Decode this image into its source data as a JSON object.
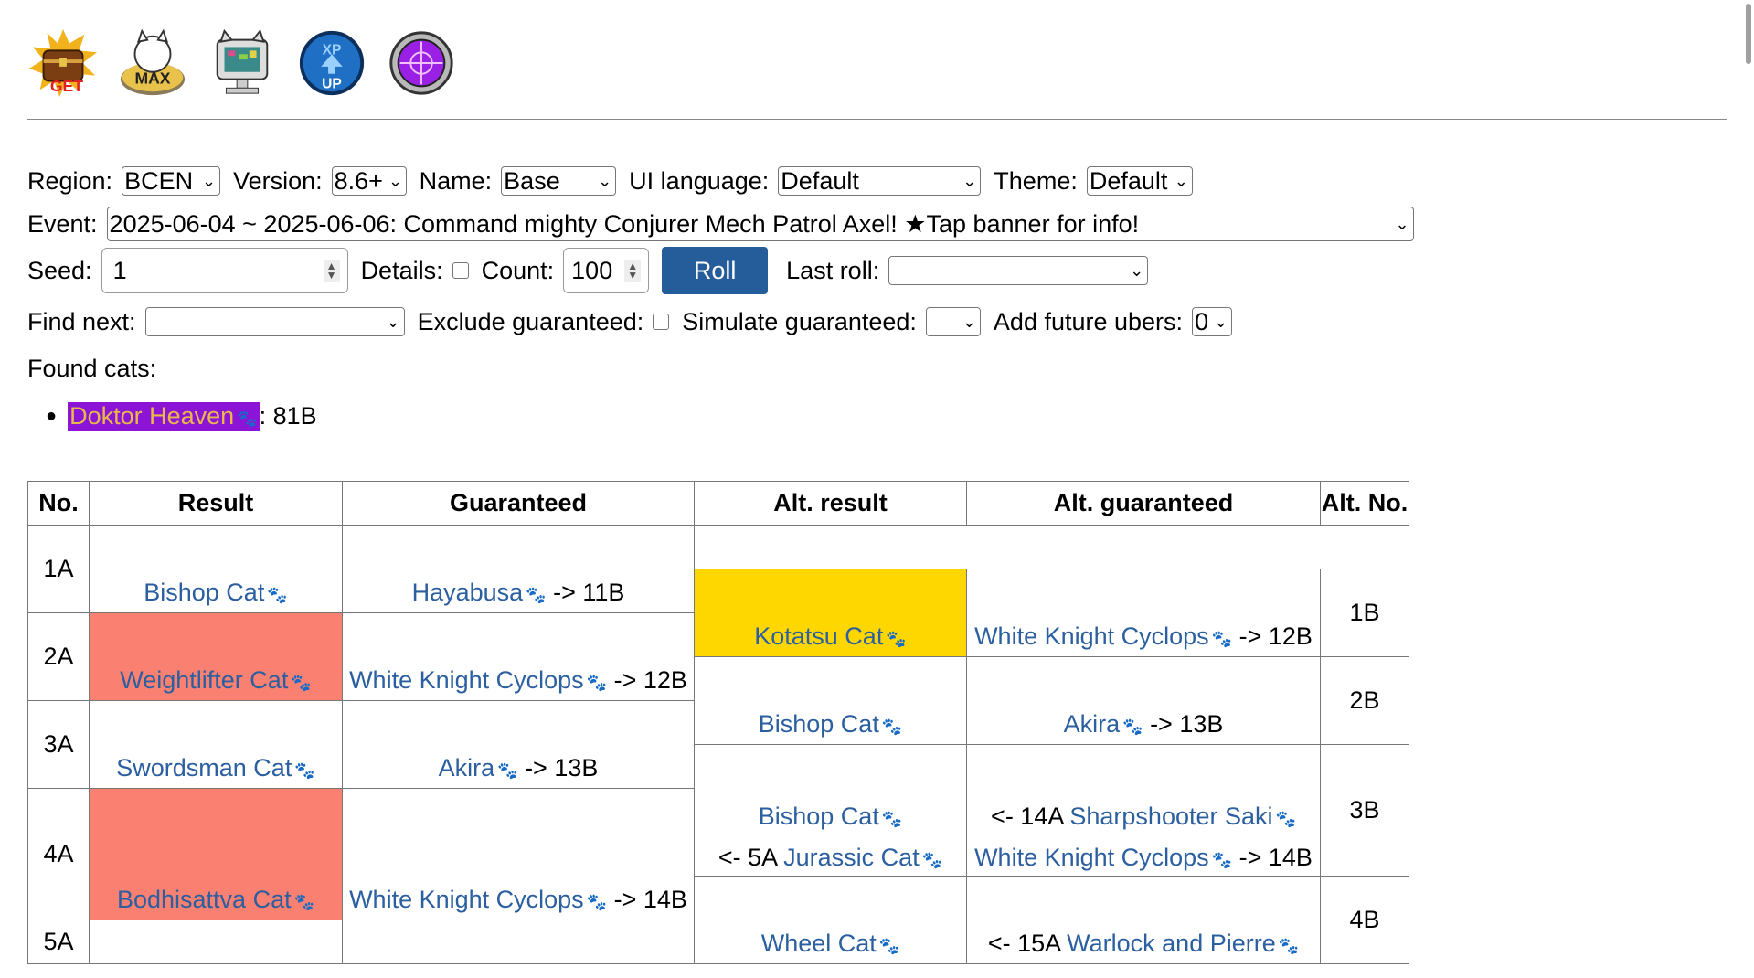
{
  "toolbar_icons": [
    {
      "name": "treasure-get-icon"
    },
    {
      "name": "max-cat-icon"
    },
    {
      "name": "computer-cat-icon"
    },
    {
      "name": "xp-up-icon"
    },
    {
      "name": "purple-orb-icon"
    }
  ],
  "controls": {
    "region_label": "Region:",
    "region_value": "BCEN",
    "version_label": "Version:",
    "version_value": "8.6+",
    "name_label": "Name:",
    "name_value": "Base",
    "ui_lang_label": "UI language:",
    "ui_lang_value": "Default",
    "theme_label": "Theme:",
    "theme_value": "Default",
    "event_label": "Event:",
    "event_value": "2025-06-04 ~ 2025-06-06: Command mighty Conjurer Mech Patrol Axel! ★Tap banner for info!",
    "seed_label": "Seed:",
    "seed_value": "1",
    "details_label": "Details:",
    "count_label": "Count:",
    "count_value": "100",
    "roll_button": "Roll",
    "last_roll_label": "Last roll:",
    "last_roll_value": "",
    "find_next_label": "Find next:",
    "find_next_value": "",
    "exclude_label": "Exclude guaranteed:",
    "simulate_label": "Simulate guaranteed:",
    "simulate_value": "",
    "future_label": "Add future ubers:",
    "future_value": "0"
  },
  "found": {
    "label": "Found cats:",
    "items": [
      {
        "name": "Doktor Heaven",
        "pos": ": 81B"
      }
    ]
  },
  "table": {
    "headers": [
      "No.",
      "Result",
      "Guaranteed",
      "Alt. result",
      "Alt. guaranteed",
      "Alt. No."
    ],
    "rows_left": [
      {
        "no": "1A",
        "result": "Bishop Cat",
        "guar": "Hayabusa",
        "guar_to": " -> 11B"
      },
      {
        "no": "2A",
        "result": "Weightlifter Cat",
        "guar": "White Knight Cyclops",
        "guar_to": " -> 12B"
      },
      {
        "no": "3A",
        "result": "Swordsman Cat",
        "guar": "Akira",
        "guar_to": " -> 13B"
      },
      {
        "no": "4A",
        "result": "Bodhisattva Cat",
        "guar": "White Knight Cyclops",
        "guar_to": " -> 14B"
      },
      {
        "no": "5A",
        "result": "",
        "guar": "",
        "guar_to": ""
      }
    ],
    "rows_right": [
      {
        "alt_result": "Kotatsu Cat",
        "alt_guar": "White Knight Cyclops",
        "alt_guar_to": " -> 12B",
        "alt_no": "1B"
      },
      {
        "alt_result": "Bishop Cat",
        "alt_guar": "Akira",
        "alt_guar_to": " -> 13B",
        "alt_no": "2B"
      },
      {
        "alt_result": "Bishop Cat",
        "alt_result2_pre": "<- 5A ",
        "alt_result2": "Jurassic Cat",
        "alt_guar_pre": "<- 14A ",
        "alt_guar": "Sharpshooter Saki",
        "alt_guar2": "White Knight Cyclops",
        "alt_guar2_to": " -> 14B",
        "alt_no": "3B"
      },
      {
        "alt_result": "Wheel Cat",
        "alt_guar_pre": "<- 15A ",
        "alt_guar": "Warlock and Pierre",
        "alt_no": "4B"
      }
    ]
  },
  "colors": {
    "rare_highlight": "#ffd700",
    "dupe_highlight": "#fa8072",
    "link": "#2b5fa0",
    "found_bg": "#8b14d6",
    "button": "#245d9a"
  }
}
